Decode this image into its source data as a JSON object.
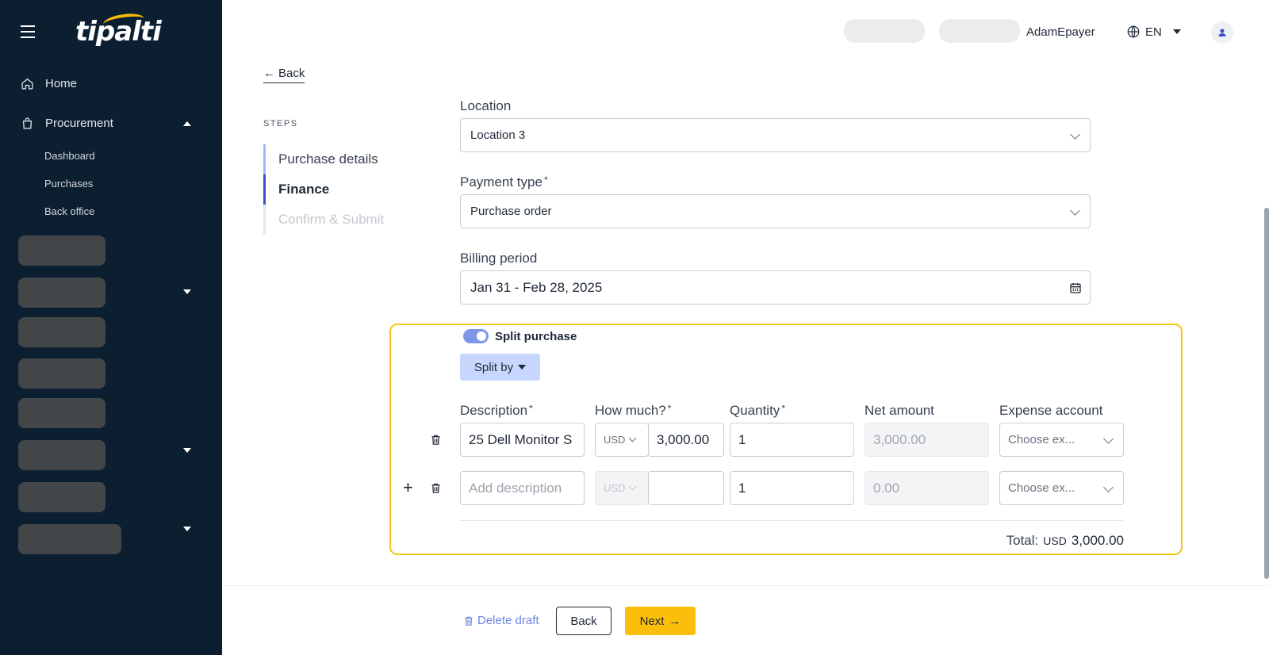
{
  "brand": {
    "logo_text": "tipalti",
    "accent": "#f5b80a",
    "sidebar_bg": "#0c1f30"
  },
  "sidebar": {
    "home": "Home",
    "procurement": "Procurement",
    "sub_items": [
      "Dashboard",
      "Purchases",
      "Back office"
    ]
  },
  "header": {
    "user_name": "AdamEpayer",
    "language": "EN"
  },
  "back_link": "Back",
  "steps": {
    "label": "STEPS",
    "items": [
      "Purchase details",
      "Finance",
      "Confirm & Submit"
    ],
    "active_index": 1
  },
  "form": {
    "location": {
      "label": "Location",
      "value": "Location 3"
    },
    "payment_type": {
      "label": "Payment type",
      "required_mark": "*",
      "value": "Purchase order"
    },
    "billing_period": {
      "label": "Billing period",
      "value": "Jan 31 - Feb 28, 2025"
    }
  },
  "split": {
    "toggle_label": "Split purchase",
    "toggle_on": true,
    "split_by_label": "Split by",
    "columns": {
      "description": "Description",
      "how_much": "How much?",
      "quantity": "Quantity",
      "net_amount": "Net amount",
      "expense_account": "Expense account",
      "required_mark": "*"
    },
    "rows": [
      {
        "description": "25 Dell Monitor S",
        "currency": "USD",
        "amount": "3,000.00",
        "quantity": "1",
        "net_amount": "3,000.00",
        "expense_account_placeholder": "Choose ex..."
      },
      {
        "description_placeholder": "Add description",
        "currency": "USD",
        "amount": "",
        "quantity": "1",
        "net_amount": "0.00",
        "expense_account_placeholder": "Choose ex..."
      }
    ],
    "total_label": "Total:",
    "total_currency": "USD",
    "total_amount": "3,000.00"
  },
  "footer": {
    "delete_draft": "Delete draft",
    "back": "Back",
    "next": "Next"
  }
}
